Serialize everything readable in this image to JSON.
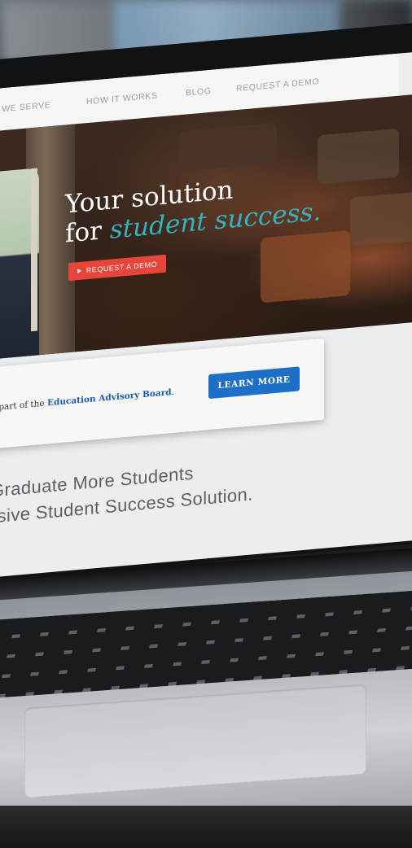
{
  "nav": {
    "items": [
      {
        "label": "O WE SERVE"
      },
      {
        "label": "HOW IT WORKS"
      },
      {
        "label": "BLOG"
      },
      {
        "label": "REQUEST A DEMO"
      }
    ]
  },
  "hero": {
    "title_line1": "Your solution",
    "title_line2_prefix": "for ",
    "title_line2_accent": "student success.",
    "cta_label": "REQUEST A DEMO"
  },
  "info_card": {
    "text_prefix": "w part of the ",
    "link_text": "Education Advisory Board",
    "text_suffix": ".",
    "button_label": "LEARN MORE"
  },
  "tagline": {
    "line1": "Graduate More Students",
    "line2": "nsive Student Success Solution."
  },
  "colors": {
    "accent_teal": "#33b3bf",
    "cta_red": "#e8453a",
    "button_blue": "#1e6fc7",
    "link_blue": "#1a5caa"
  },
  "icons": {
    "cta_icon": "play-triangle-icon"
  }
}
